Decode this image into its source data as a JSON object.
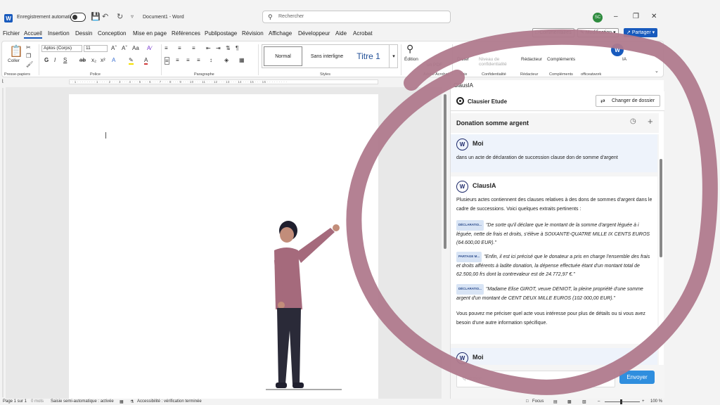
{
  "titlebar": {
    "autosave_label": "Enregistrement automatique",
    "document_title": "Document1 - Word",
    "search_placeholder": "Rechercher",
    "avatar_initials": "SC"
  },
  "menu": {
    "items": [
      "Fichier",
      "Accueil",
      "Insertion",
      "Dessin",
      "Conception",
      "Mise en page",
      "Références",
      "Publipostage",
      "Révision",
      "Affichage",
      "Développeur",
      "Aide",
      "Acrobat"
    ],
    "active": "Accueil",
    "comments_label": "Commentaires",
    "modification_label": "Modification",
    "share_label": "Partager"
  },
  "ribbon": {
    "paste_label": "Coller",
    "font_name": "Aptos (Corps)",
    "font_size": "11",
    "styles": {
      "normal": "Normal",
      "no_spacing": "Sans interligne",
      "title1": "Titre 1"
    },
    "edit_label": "Édition",
    "pdf_label": "un PDF",
    "dictate_label": "Dicter",
    "confidentiality_label": "Niveau de confidentialité",
    "editor_label": "Rédacteur",
    "addins_label": "Compléments",
    "ia_label": "IA",
    "groups": {
      "clipboard": "Presse-papiers",
      "font": "Police",
      "paragraph": "Paragraphe",
      "styles": "Styles",
      "adobe": "Adobe Acrobat",
      "voice": "Voix",
      "confidentiality": "Confidentialité",
      "editor": "Rédacteur",
      "addins": "Compléments",
      "officeatwork": "officeatwork"
    }
  },
  "ruler": {
    "marks": "· · 1 · · · · · · · · 1 · · · · 2 · · · 3 · · · 4 · · · 5 · · · 6 · · · 7 · · · 8 · · · 9 · · · 10 · · · 11 · · · 12 · · · 13 · · · 14 · · · 15 · · · 16 · · · · · · · · ·"
  },
  "pane": {
    "title": "ClausIA",
    "clausier_label": "Clausier Etude",
    "change_folder_label": "Changer de dossier",
    "conversation_title": "Donation somme argent",
    "messages": [
      {
        "author": "Moi",
        "text": "dans un acte de déclaration de succession clause don de somme d'argent"
      },
      {
        "author": "ClausIA",
        "intro": "Plusieurs actes contiennent des clauses relatives à des dons de sommes d'argent dans le cadre de successions. Voici quelques extraits pertinents :",
        "excerpts": [
          {
            "tag": "DÉCLARATIO...",
            "text": "\"De sorte qu'il déclare que le montant de la somme d'argent léguée à i léguée, nette de frais et droits, s'élève à SOIXANTE-QUATRE MILLE IX CENTS EUROS (64.600,00 EUR).\""
          },
          {
            "tag": "PARTAGE M...",
            "text": "\"Enfin, il est ici précisé que le donateur a pris en charge l'ensemble des frais et droits afférents à ladite donation, la dépense effectuée étant d'un montant total de 62.500,00 frs dont la contrevaleur est de 24.772,97 €.\""
          },
          {
            "tag": "DÉCLARATIO...",
            "text": "\"Madame Elise GIROT, veuve DENIOT, la pleine propriété d'une somme argent d'un montant de CENT DEUX MILLE EUROS (102 000,00 EUR).\""
          }
        ],
        "outro": "Vous pouvez me préciser quel acte vous intéresse pour plus de détails ou si vous avez besoin d'une autre information spécifique."
      },
      {
        "author": "Moi"
      }
    ],
    "input_placeholder": "Question",
    "send_label": "Envoyer"
  },
  "statusbar": {
    "page": "Page 1 sur 1",
    "words": "0 mots",
    "autocomplete": "Saisie semi-automatique : activée",
    "accessibility": "Accessibilité : vérification terminée",
    "focus": "Focus",
    "zoom": "100 %"
  },
  "colors": {
    "accent": "#185abd",
    "ring": "#b07a8d",
    "send": "#2f8ede"
  }
}
